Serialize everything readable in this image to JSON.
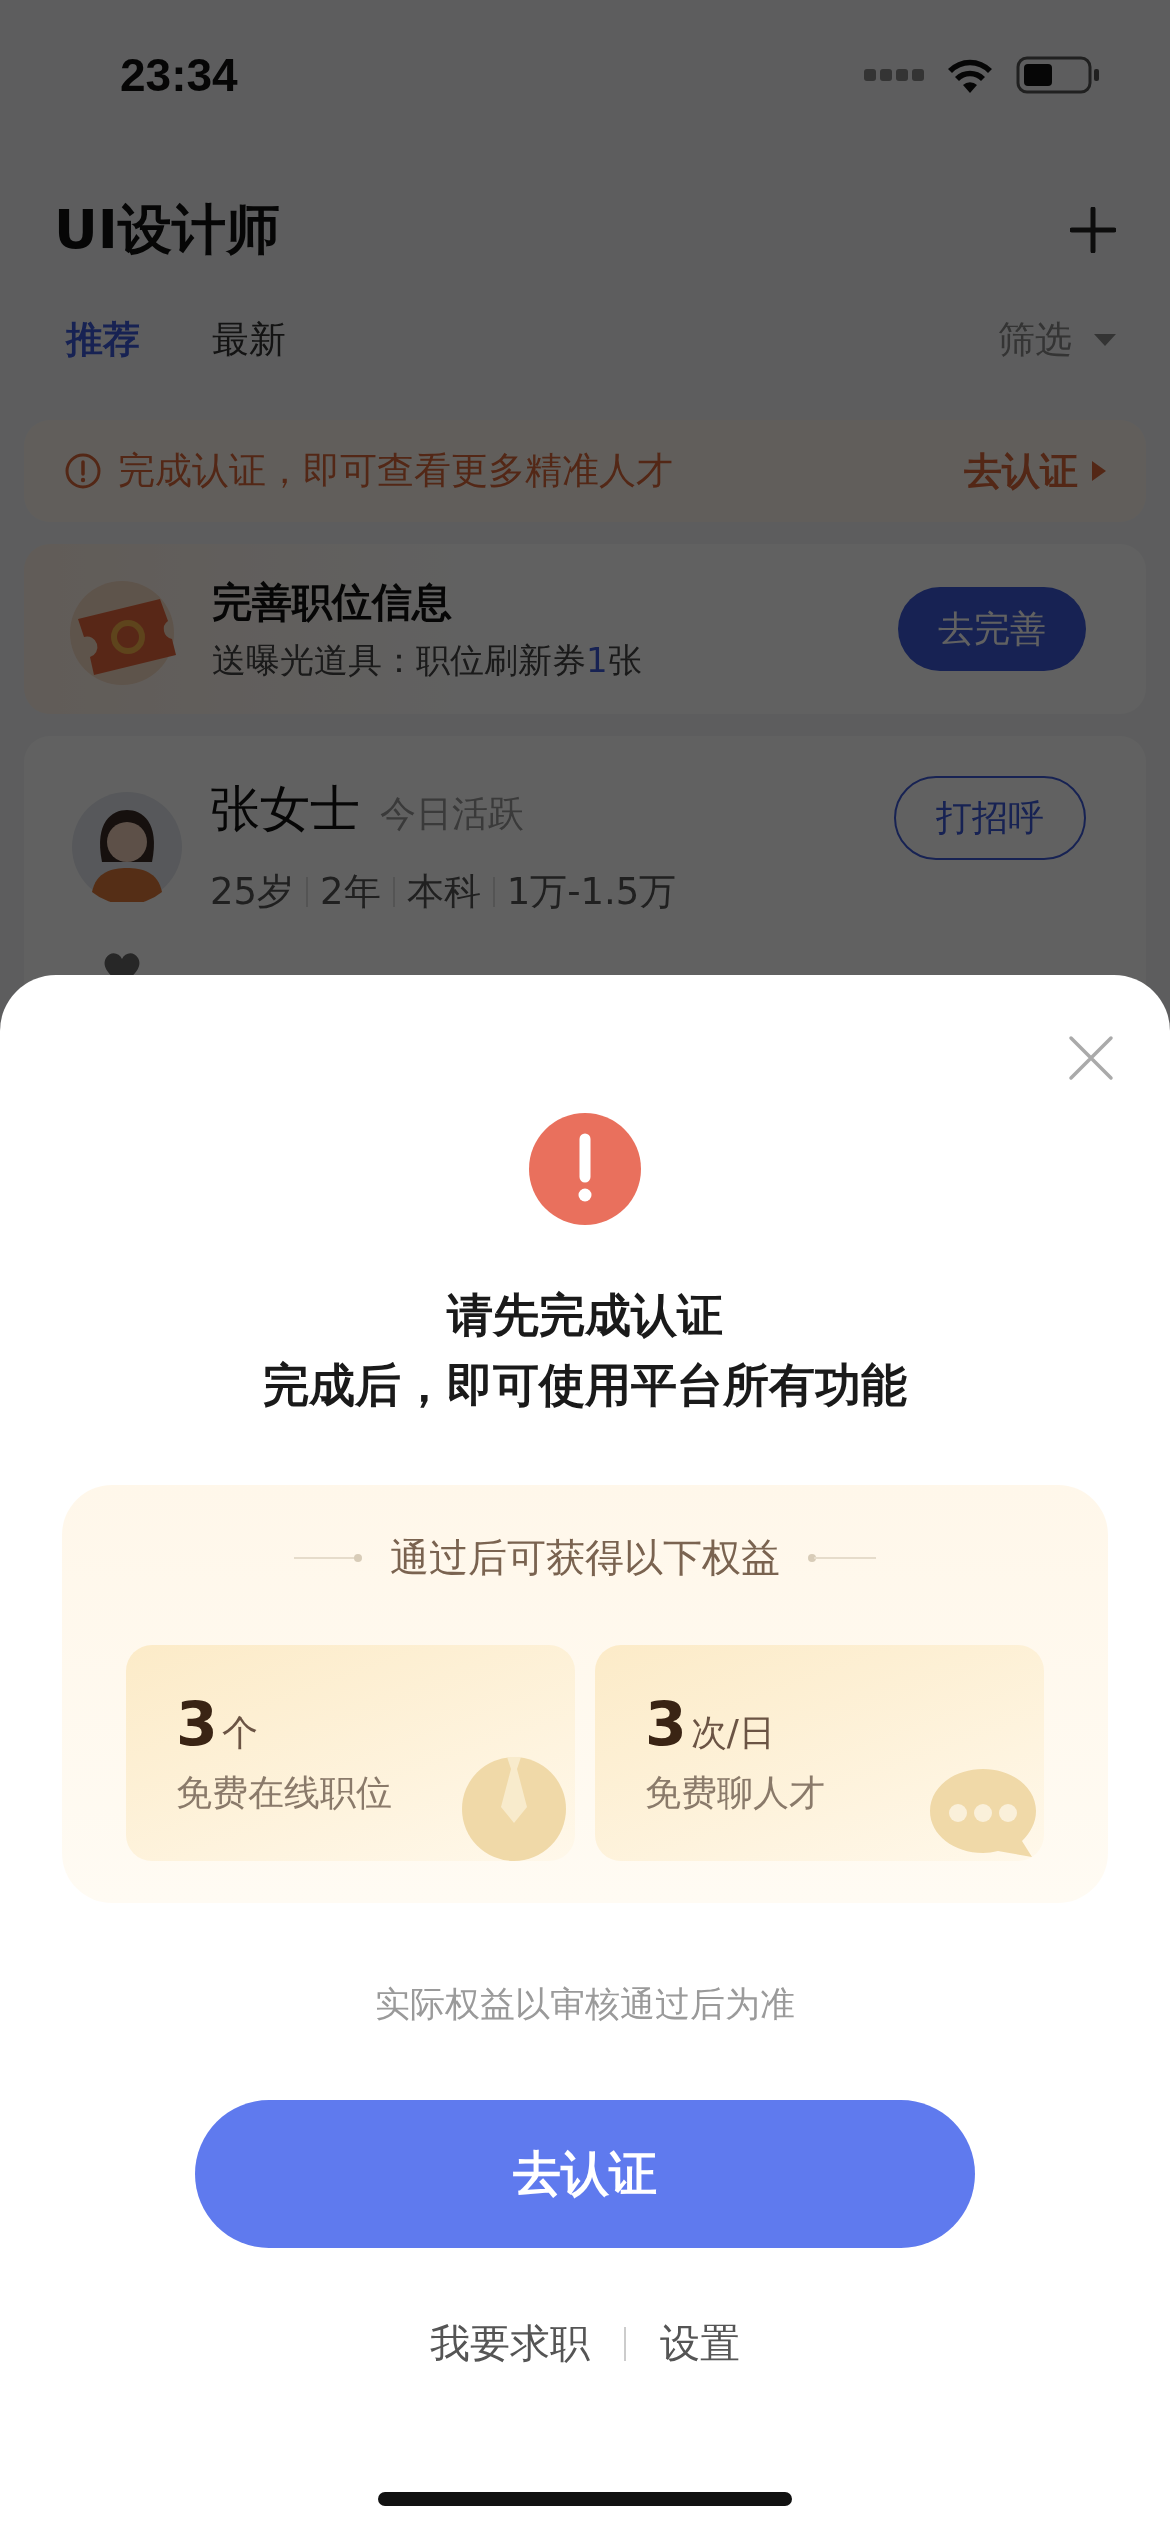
{
  "status_bar": {
    "time": "23:34"
  },
  "header": {
    "title": "UI设计师"
  },
  "tabs": [
    {
      "label": "推荐",
      "selected": true
    },
    {
      "label": "最新",
      "selected": false
    }
  ],
  "filter": {
    "label": "筛选"
  },
  "notice": {
    "text": "完成认证，即可查看更多精准人才",
    "action": "去认证"
  },
  "promo": {
    "title": "完善职位信息",
    "subtitle": "送曝光道具：职位刷新券",
    "count": "1",
    "count_unit": "张",
    "button": "去完善"
  },
  "candidate": {
    "name": "张女士",
    "activity": "今日活跃",
    "tags": [
      "25岁",
      "2年",
      "本科",
      "1万-1.5万"
    ],
    "button": "打招呼"
  },
  "dialog": {
    "title": "请先完成认证",
    "subtitle": "完成后，即可使用平台所有功能",
    "benefits_title": "通过后可获得以下权益",
    "benefits": [
      {
        "kind": "job",
        "value": "3",
        "unit": "个",
        "label": "免费在线职位"
      },
      {
        "kind": "chat",
        "value": "3",
        "unit": "次/日",
        "label": "免费聊人才"
      }
    ],
    "note": "实际权益以审核通过后为准",
    "primary_button": "去认证",
    "links": [
      "我要求职",
      "设置"
    ]
  }
}
